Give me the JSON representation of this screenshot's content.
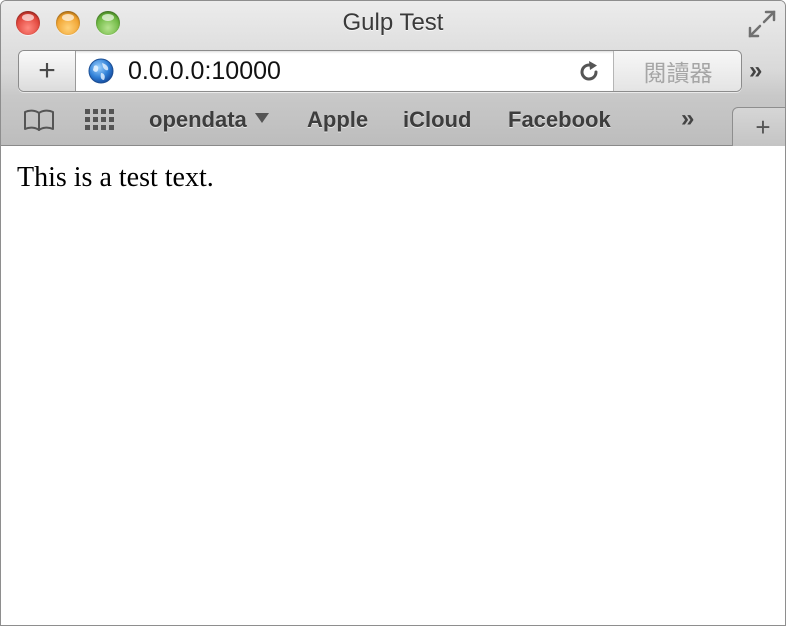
{
  "window": {
    "title": "Gulp Test"
  },
  "toolbar": {
    "add_label": "+",
    "url": "0.0.0.0:10000",
    "reader_label": "閱讀器",
    "overflow_label": "»"
  },
  "bookmarks": {
    "items": [
      {
        "label": "opendata",
        "has_menu": true
      },
      {
        "label": "Apple"
      },
      {
        "label": "iCloud"
      },
      {
        "label": "Facebook"
      }
    ],
    "overflow_label": "»",
    "new_tab_label": "+"
  },
  "page": {
    "text": "This is a test text."
  },
  "icons": {
    "close": "close-icon",
    "minimize": "minimize-icon",
    "zoom": "zoom-icon",
    "fullscreen": "fullscreen-icon",
    "globe": "globe-icon",
    "reload": "reload-icon",
    "reading_list": "book-icon",
    "top_sites": "grid-icon"
  },
  "colors": {
    "close": "#e0443a",
    "minimize": "#f0a22e",
    "zoom": "#6bb63f"
  }
}
